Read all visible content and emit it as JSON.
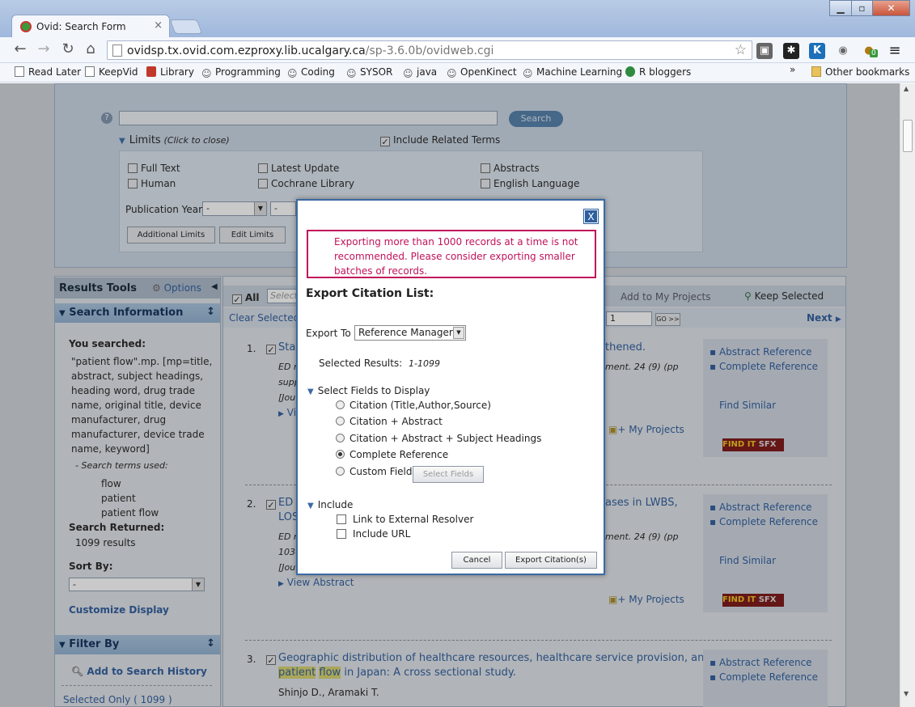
{
  "browser": {
    "tab_title": "Ovid: Search Form",
    "url_host": "ovidsp.tx.ovid.com.ezproxy.lib.ucalgary.ca",
    "url_path": "/sp-3.6.0b/ovidweb.cgi",
    "bookmarks": [
      "Read Later",
      "KeepVid",
      "Library",
      "Programming",
      "Coding",
      "SYSOR",
      "java",
      "OpenKinect",
      "Machine Learning",
      "R bloggers"
    ],
    "other_bookmarks": "Other bookmarks",
    "ext_badge": "0"
  },
  "search": {
    "button": "Search",
    "limits_label": "Limits",
    "limits_hint": "(Click to close)",
    "include_related": "Include Related Terms",
    "limits": {
      "full_text": "Full Text",
      "human": "Human",
      "latest_update": "Latest Update",
      "cochrane": "Cochrane Library",
      "abstracts": "Abstracts",
      "english": "English Language"
    },
    "pub_year_label": "Publication Year",
    "pub_year_value": "-",
    "pub_year_value2": "-",
    "additional_limits": "Additional Limits",
    "edit_limits": "Edit Limits"
  },
  "left": {
    "results_tools": "Results Tools",
    "options": "Options",
    "search_information": "Search Information",
    "you_searched_label": "You searched:",
    "query_lines": [
      "\"patient flow\".mp. [mp=title,",
      "abstract, subject headings,",
      "heading word, drug trade",
      "name, original title, device",
      "manufacturer, drug",
      "manufacturer, device trade",
      "name, keyword]"
    ],
    "search_terms_label": "- Search terms used:",
    "terms": [
      "flow",
      "patient",
      "patient flow"
    ],
    "search_returned_label": "Search Returned:",
    "results_count": "1099 results",
    "sort_by_label": "Sort By:",
    "sort_value": "-",
    "customize_display": "Customize Display",
    "filter_by": "Filter By",
    "add_to_history": "Add to Search History",
    "selected_only": "Selected Only ( 1099 )"
  },
  "main": {
    "all_label": "All",
    "select_placeholder": "Select",
    "add_to_projects": "Add to My Projects",
    "keep_selected": "Keep Selected",
    "clear_selected": "Clear Selected",
    "page_input": "1",
    "go": "GO >>",
    "next": "Next",
    "results": [
      {
        "num": "1.",
        "title_start": "Sta",
        "title_end": "thened.",
        "line2_start": "ED r",
        "line2_end": "ment. 24 (9) (pp",
        "line3": "supp",
        "line4": "[Jou",
        "view": "Vi"
      },
      {
        "num": "2.",
        "title_start": "ED t",
        "title_end": "ases in LWBS,",
        "title2": "LOS",
        "line2_start": "ED r",
        "line2_end": "ment. 24 (9) (pp",
        "line3": "103-",
        "line4": "[Jou",
        "view": "View Abstract"
      },
      {
        "num": "3.",
        "title": "Geographic distribution of healthcare resources, healthcare service provision, and",
        "title2_pre": "",
        "hl1": "patient",
        "hl2": "flow",
        "title2_post": "in Japan: A cross sectional study.",
        "authors": "Shinjo D., Aramaki T."
      }
    ],
    "side_links": {
      "abstract_reference": "Abstract Reference",
      "complete_reference": "Complete Reference",
      "find_similar": "Find Similar",
      "my_projects": "+ My Projects",
      "find_it": "FIND IT",
      "sfx": "SFX"
    }
  },
  "dialog": {
    "close": "X",
    "warning": "Exporting more than 1000 records at a time is not recommended. Please consider exporting smaller batches of records.",
    "title": "Export Citation List:",
    "export_to_label": "Export To",
    "export_to_value": "Reference Manager",
    "selected_results_label": "Selected Results:",
    "selected_results_value": "1-1099",
    "fields_heading": "Select Fields to Display",
    "fields": [
      "Citation (Title,Author,Source)",
      "Citation + Abstract",
      "Citation + Abstract + Subject Headings",
      "Complete Reference",
      "Custom Fields"
    ],
    "fields_selected": "Complete Reference",
    "select_fields_button": "Select Fields",
    "include_heading": "Include",
    "include_options": [
      "Link to External Resolver",
      "Include URL"
    ],
    "cancel": "Cancel",
    "export_button": "Export Citation(s)"
  }
}
